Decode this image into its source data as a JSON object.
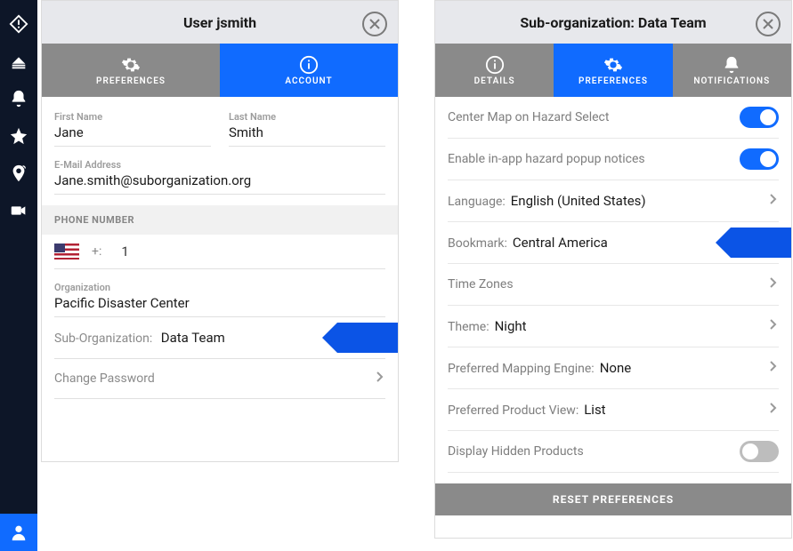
{
  "nav": {
    "items": [
      "alert-diamond",
      "disk",
      "bell",
      "star",
      "pin",
      "camera"
    ],
    "active": "user"
  },
  "user_panel": {
    "title": "User jsmith",
    "tabs": [
      {
        "id": "preferences",
        "label": "PREFERENCES"
      },
      {
        "id": "account",
        "label": "ACCOUNT"
      }
    ],
    "active_tab": "account",
    "first_name_label": "First Name",
    "first_name": "Jane",
    "last_name_label": "Last Name",
    "last_name": "Smith",
    "email_label": "E-Mail Address",
    "email": "Jane.smith@suborganization.org",
    "phone_header": "PHONE NUMBER",
    "phone_cc_label": "+:",
    "phone_cc": "1",
    "org_label": "Organization",
    "org": "Pacific Disaster Center",
    "suborg_label": "Sub-Organization:",
    "suborg": "Data Team",
    "change_pw": "Change Password"
  },
  "org_panel": {
    "title": "Sub-organization: Data Team",
    "tabs": [
      {
        "id": "details",
        "label": "DETAILS"
      },
      {
        "id": "preferences",
        "label": "PREFERENCES"
      },
      {
        "id": "notifications",
        "label": "NOTIFICATIONS"
      }
    ],
    "active_tab": "preferences",
    "prefs": {
      "center_map": "Center Map on Hazard Select",
      "popup": "Enable in-app hazard popup notices",
      "language_label": "Language:",
      "language": "English (United States)",
      "bookmark_label": "Bookmark:",
      "bookmark": "Central America",
      "timezones": "Time Zones",
      "theme_label": "Theme:",
      "theme": "Night",
      "map_engine_label": "Preferred Mapping Engine:",
      "map_engine": "None",
      "product_view_label": "Preferred Product View:",
      "product_view": "List",
      "hidden_products": "Display Hidden Products",
      "reset": "RESET PREFERENCES"
    }
  }
}
